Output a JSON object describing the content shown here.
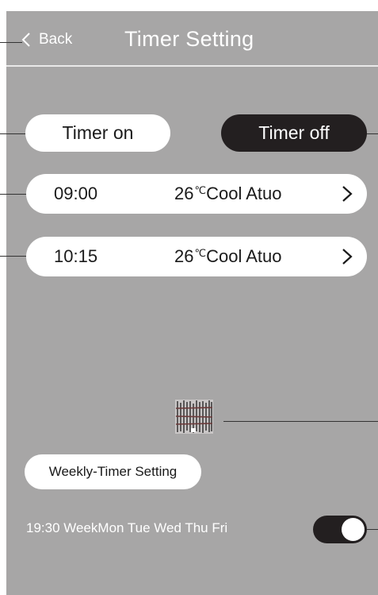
{
  "header": {
    "back_label": "Back",
    "title": "Timer Setting"
  },
  "tabs": {
    "on_label": "Timer on",
    "off_label": "Timer off",
    "active": "Timer off"
  },
  "timers": [
    {
      "time": "09:00",
      "temp": "26",
      "unit": "℃",
      "mode": "Cool Atuo"
    },
    {
      "time": "10:15",
      "temp": "26",
      "unit": "℃",
      "mode": "Cool Atuo"
    }
  ],
  "weekly": {
    "button_label": "Weekly-Timer Setting",
    "schedule_text": "19:30 WeekMon Tue Wed Thu Fri",
    "toggle_on": true
  },
  "colors": {
    "panel": "#a7a6a6",
    "active_pill": "#231f20",
    "pill": "#ffffff",
    "text_light": "#ffffff"
  },
  "icons": [
    "back-chevron-icon",
    "chevron-right-icon",
    "glyph-image-icon"
  ]
}
